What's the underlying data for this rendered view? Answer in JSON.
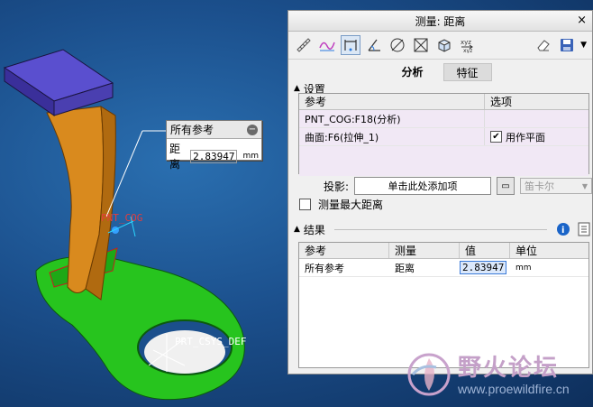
{
  "viewport": {
    "callout": {
      "title": "所有参考",
      "row_label": "距离",
      "value": "2.83947",
      "unit": "mm"
    },
    "labels": {
      "cog": "PNT_COG",
      "csys": "PRT_CSYS_DEF"
    }
  },
  "dialog": {
    "title": "测量: 距离",
    "close": "×",
    "toolbar_icons": [
      "length-icon",
      "curve-length-icon",
      "distance-icon",
      "angle-icon",
      "diameter-icon",
      "area-icon",
      "volume-icon",
      "transform-icon",
      "eraser-icon",
      "save-icon"
    ],
    "tabs": [
      "分析",
      "特征"
    ],
    "settings": {
      "header": "设置",
      "columns": [
        "参考",
        "选项"
      ],
      "rows": [
        {
          "ref": "PNT_COG:F18(分析)",
          "option": ""
        },
        {
          "ref": "曲面:F6(拉伸_1)",
          "option": "用作平面",
          "checked": true
        }
      ]
    },
    "projection": {
      "label": "投影:",
      "placeholder": "单击此处添加项",
      "mode": "笛卡尔"
    },
    "max_distance": {
      "label": "测量最大距离",
      "checked": false
    },
    "results": {
      "header": "结果",
      "columns": [
        "参考",
        "测量",
        "值",
        "单位"
      ],
      "rows": [
        {
          "ref": "所有参考",
          "measure": "距离",
          "value": "2.83947",
          "unit": "mm"
        }
      ]
    }
  },
  "watermark": {
    "title": "野火论坛",
    "url": "www.proewildfire.cn"
  },
  "colors": {
    "part_orange": "#d98a1e",
    "part_green": "#27c41e",
    "block_purple": "#4a3fb0",
    "background": "#1b4f8c"
  }
}
